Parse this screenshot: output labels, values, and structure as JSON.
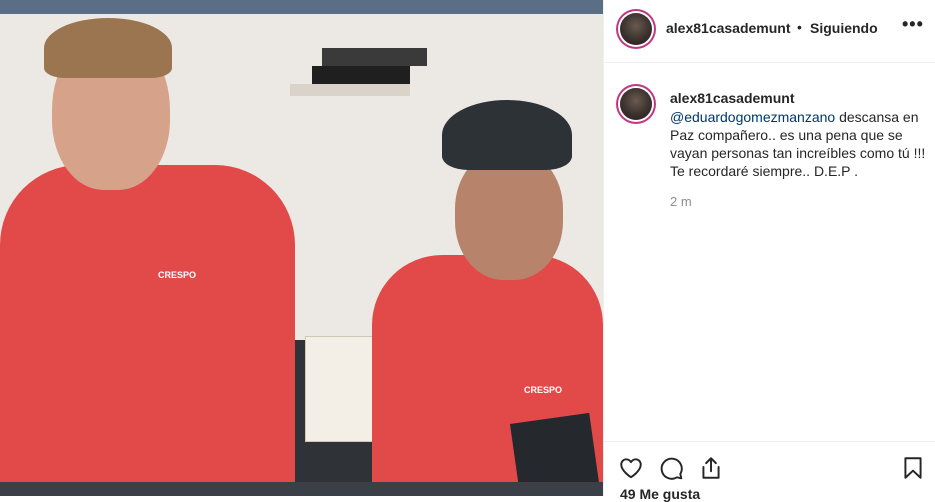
{
  "post": {
    "username": "alex81casademunt",
    "separator": "•",
    "follow_status": "Siguiendo",
    "more_icon": "more-horizontal-icon",
    "caption": {
      "username": "alex81casademunt",
      "mention": "@eduardogomezmanzano",
      "text": " descansa en Paz compañero.. es una pena que se vayan personas tan increíbles como tú !!! Te recordaré siempre.. D.E.P ."
    },
    "time": "2 m",
    "likes": "49 Me gusta"
  },
  "photo": {
    "shirt_logo_text": "CRESPO"
  },
  "icons": {
    "like": "heart-icon",
    "comment": "comment-bubble-icon",
    "share": "share-icon",
    "save": "bookmark-icon"
  },
  "colors": {
    "text": "#262626",
    "secondary": "#8e8e8e",
    "mention": "#00376b",
    "border": "#efefef"
  }
}
